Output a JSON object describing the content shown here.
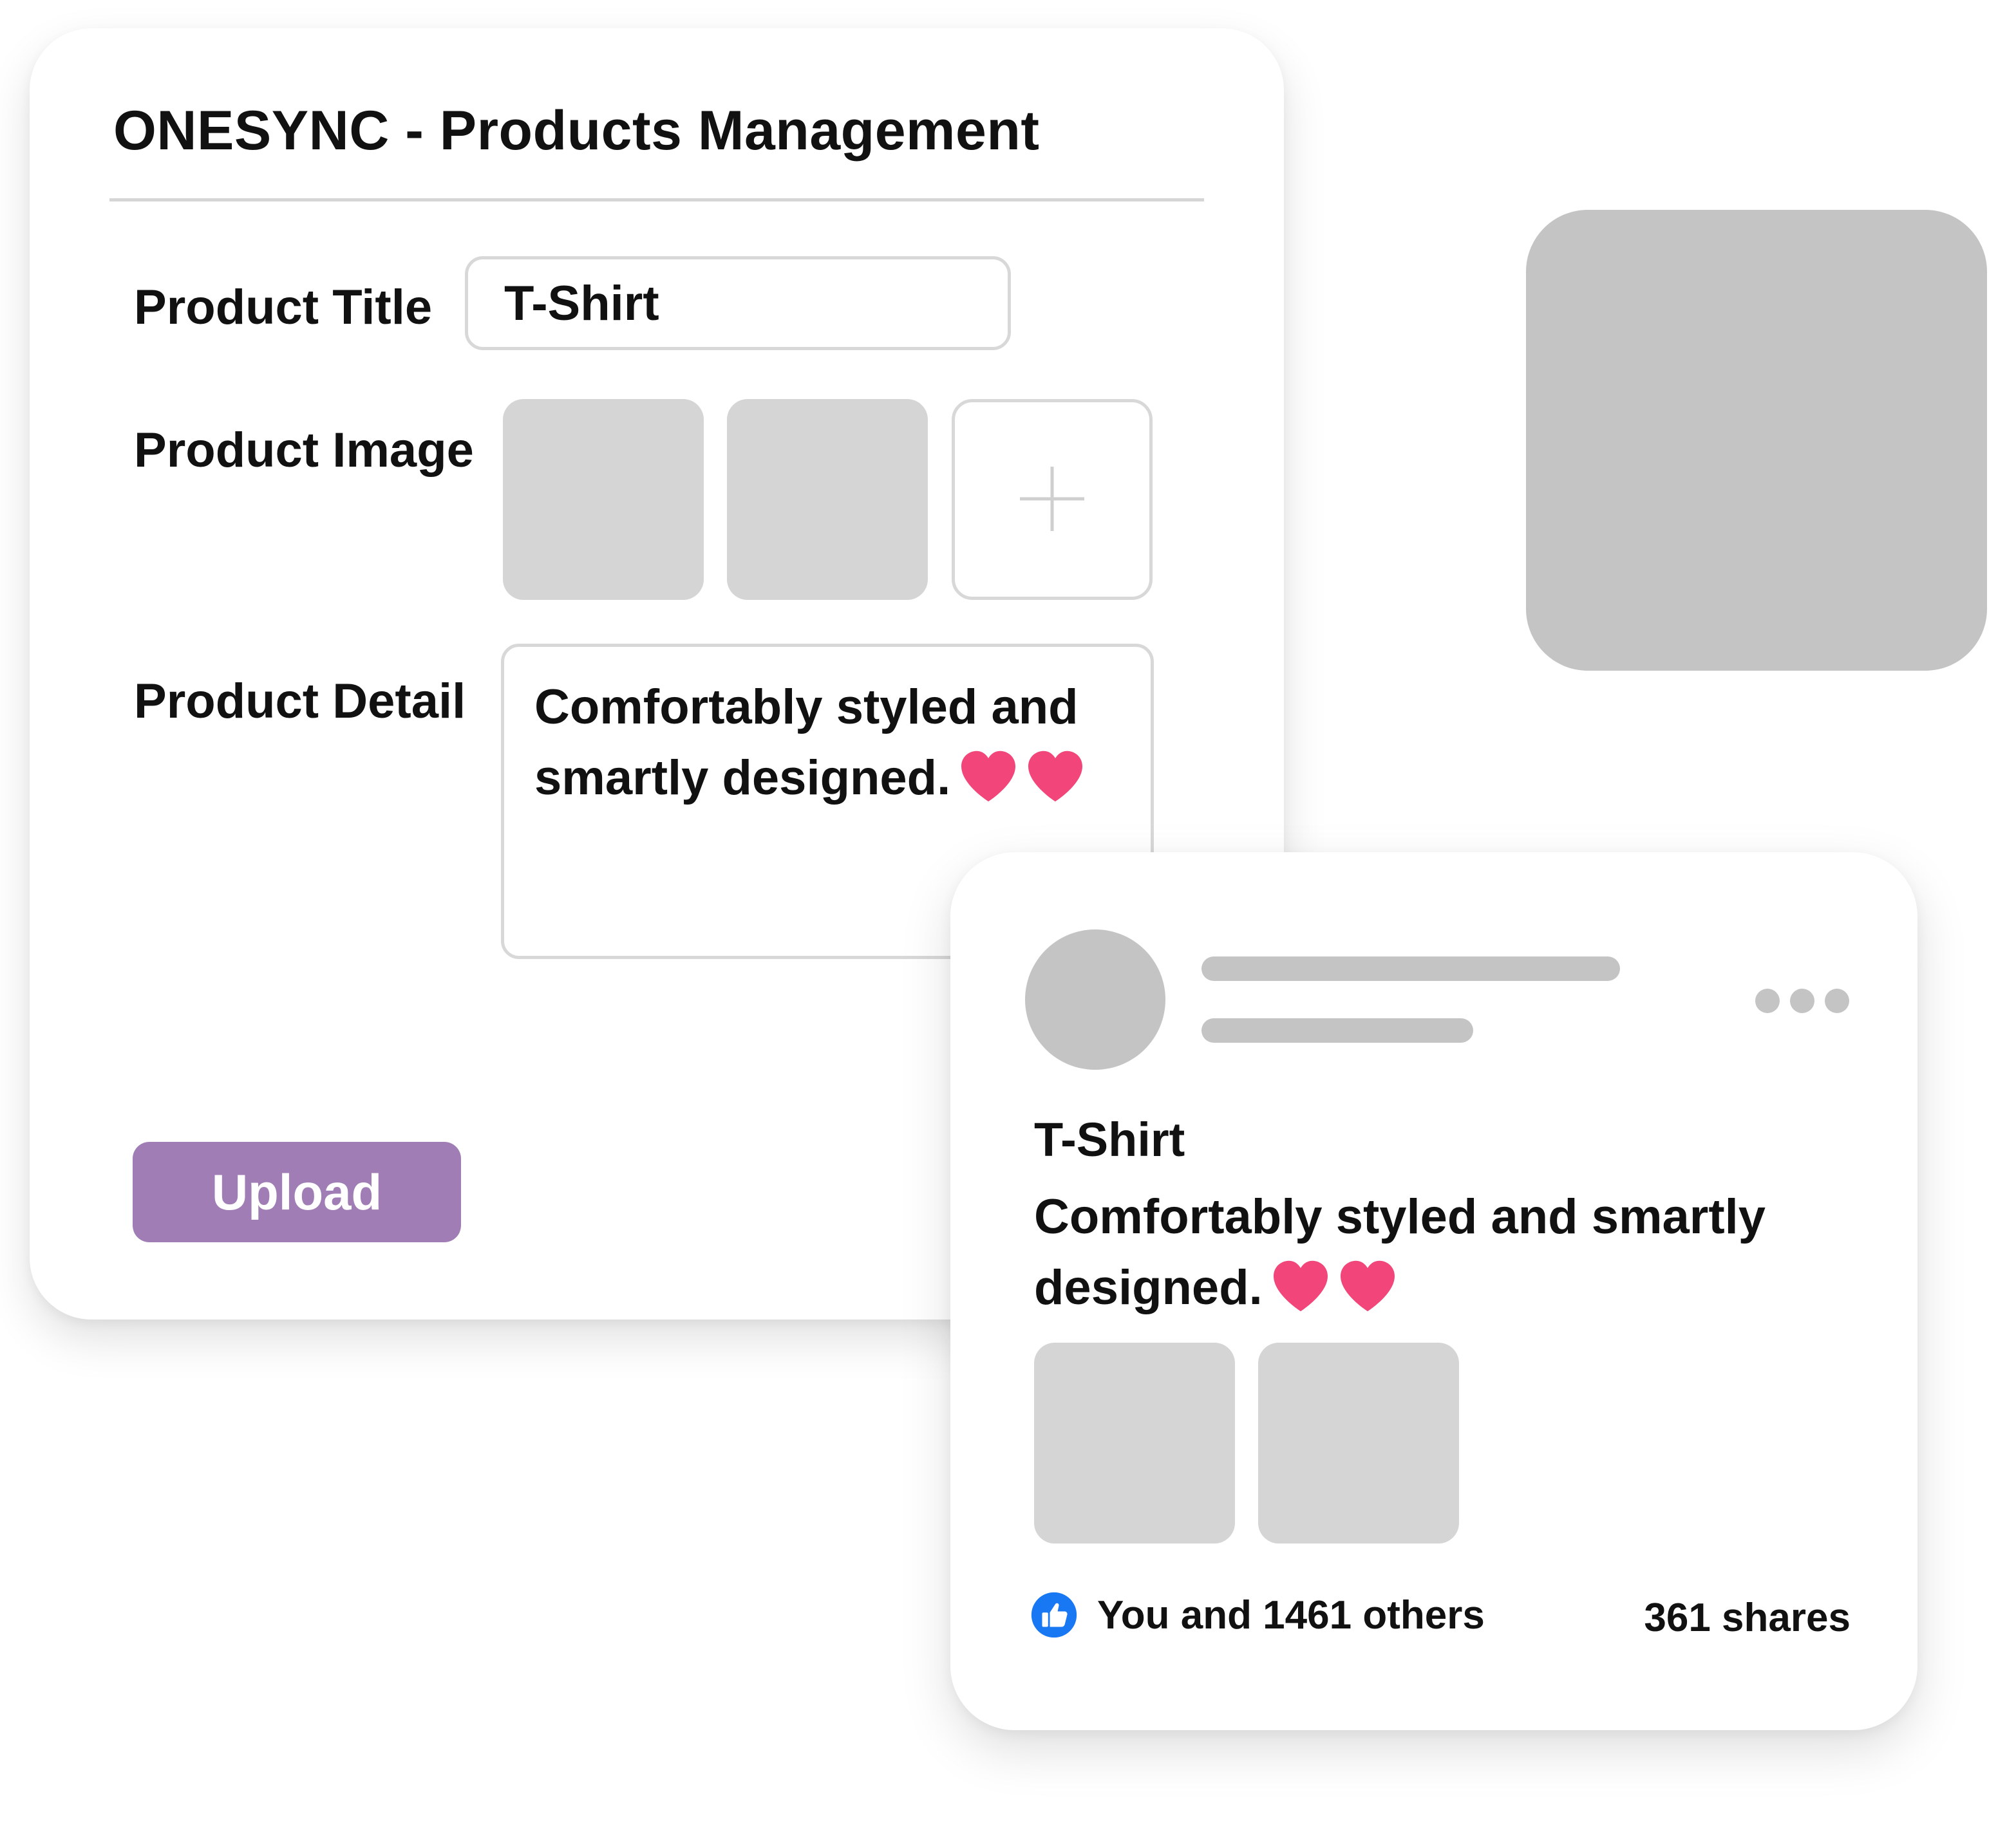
{
  "admin": {
    "title": "ONESYNC - Products Management",
    "fields": {
      "title_label": "Product Title",
      "title_value": "T-Shirt",
      "image_label": "Product Image",
      "detail_label": "Product Detail",
      "detail_value": "Comfortably styled and smartly designed."
    },
    "add_image_icon": "plus-icon",
    "upload_label": "Upload"
  },
  "post": {
    "title": "T-Shirt",
    "text": "Comfortably styled and smartly designed.",
    "likes_text": "You and 1461 others",
    "shares_text": "361 shares",
    "like_icon": "thumbs-up-icon",
    "more_icon": "more-dots-icon"
  },
  "colors": {
    "accent": "#a17db6",
    "heart": "#f2467a",
    "like_blue": "#1877f2",
    "placeholder": "#c4c4c4",
    "placeholder_light": "#d5d5d5",
    "decor_arc": "#ede6f5"
  }
}
